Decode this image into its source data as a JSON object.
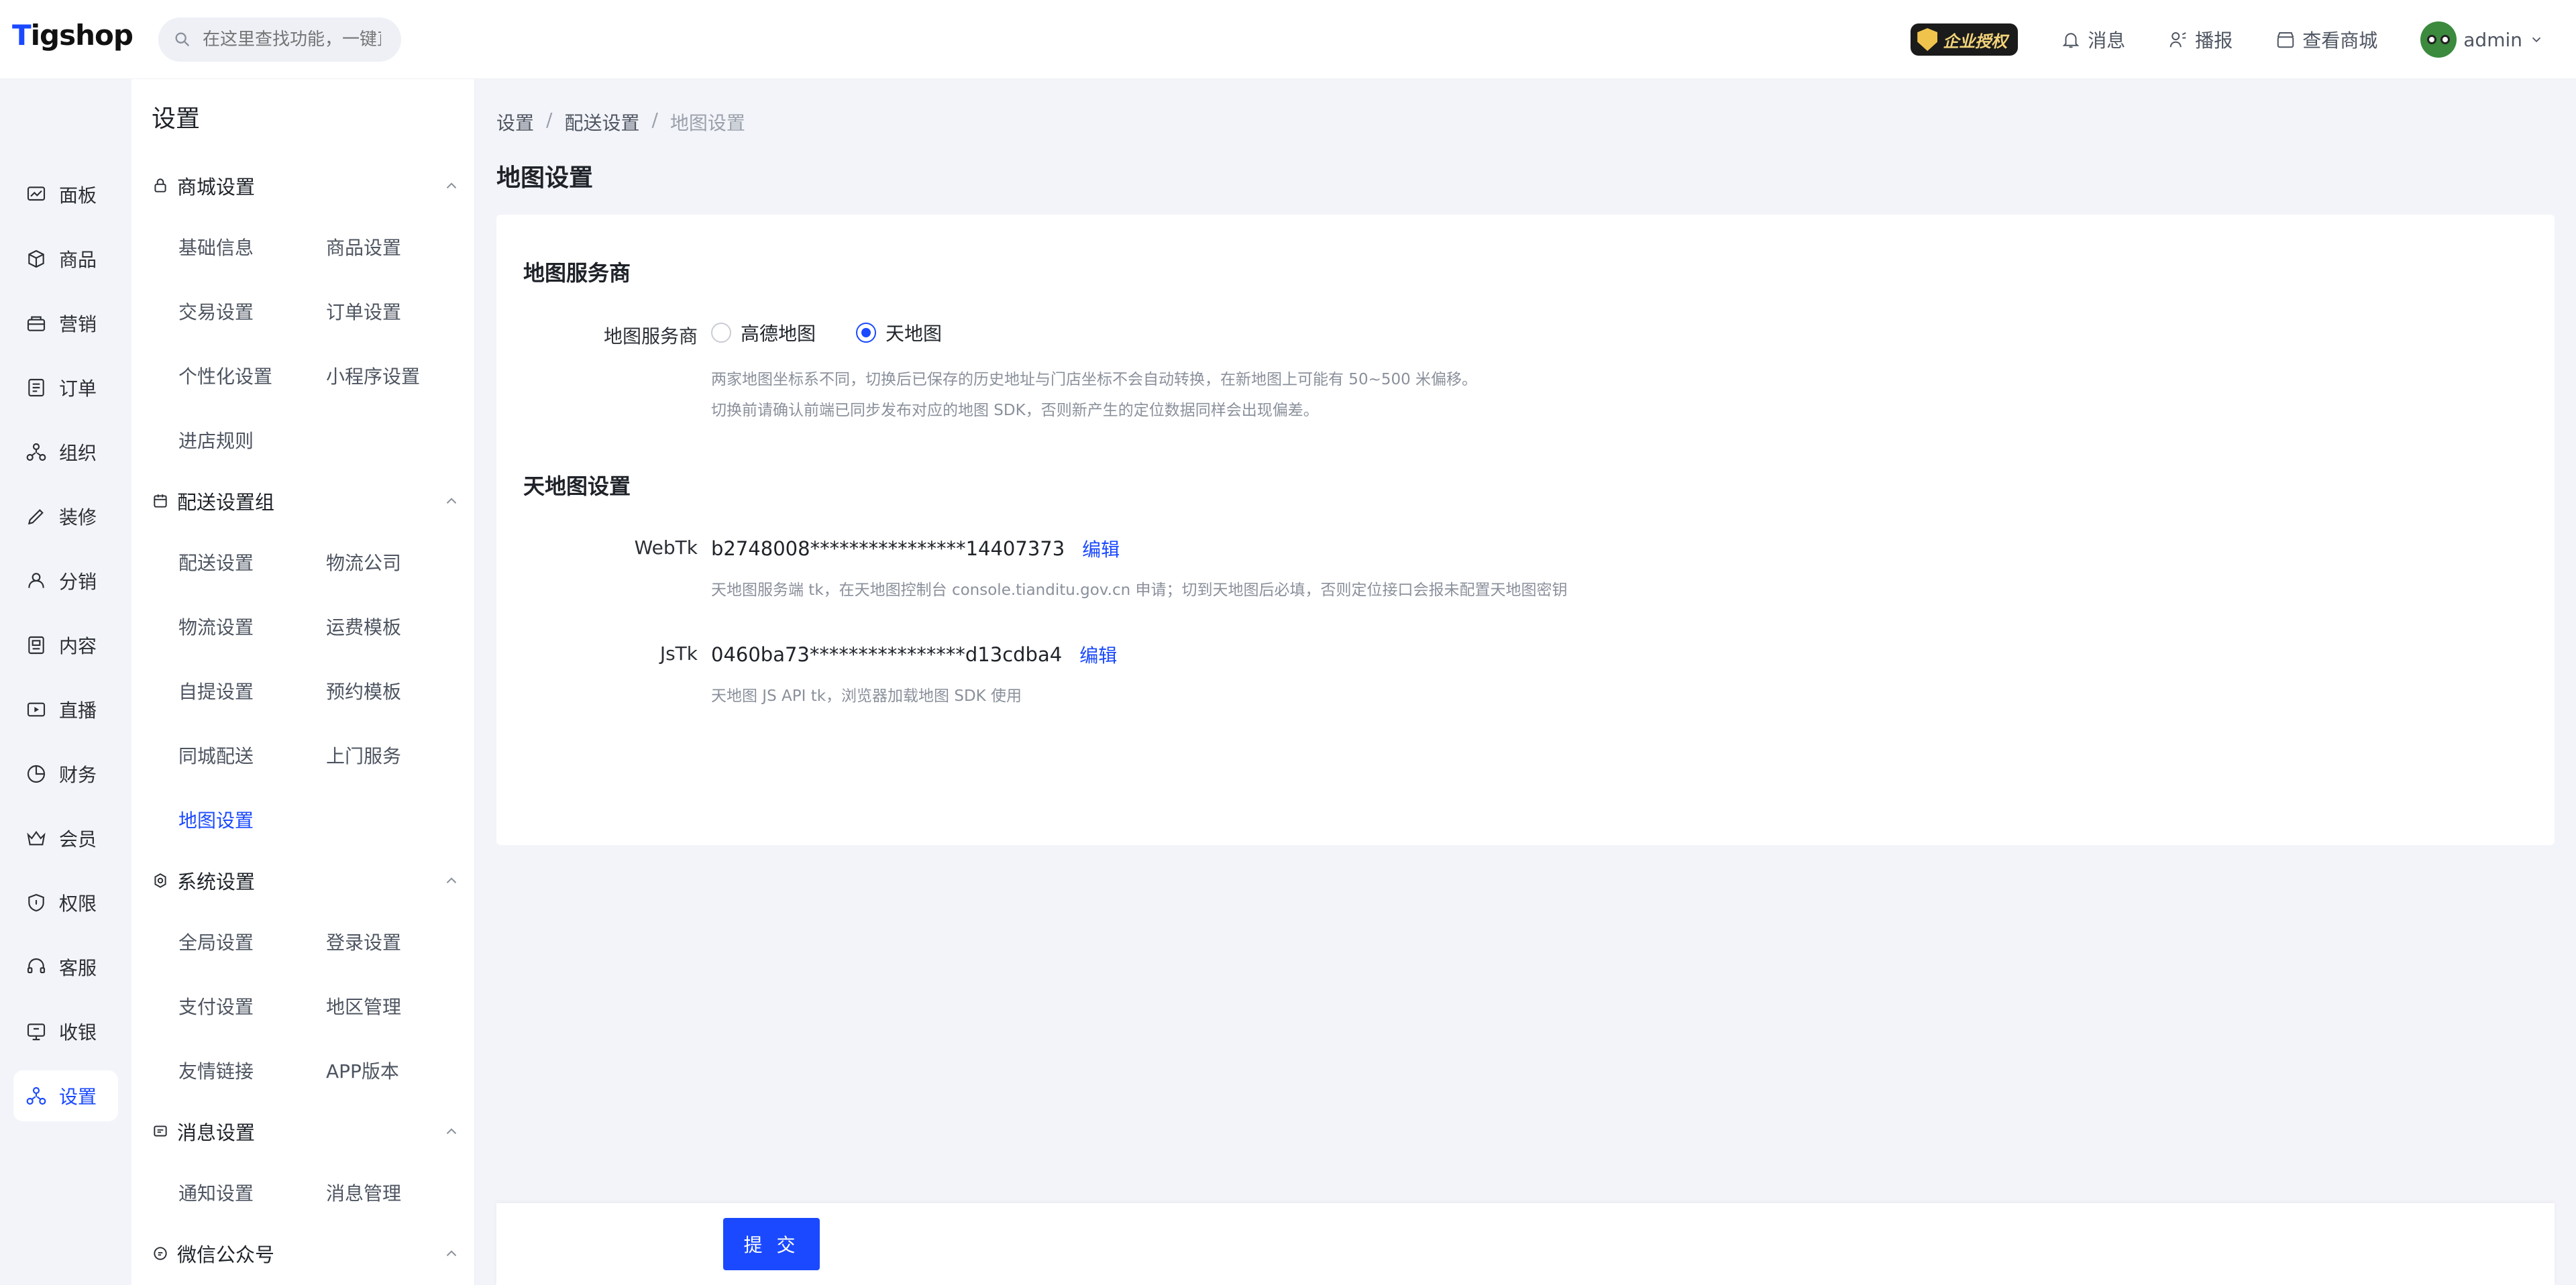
{
  "app": {
    "logo": "Tigshop",
    "search_placeholder": "在这里查找功能，一键直达"
  },
  "topbar": {
    "badge": "企业授权",
    "messages": "消息",
    "broadcast": "播报",
    "view_store": "查看商城",
    "user": "admin"
  },
  "leftnav": {
    "items": [
      {
        "label": "面板",
        "icon": "chart-icon"
      },
      {
        "label": "商品",
        "icon": "box-icon"
      },
      {
        "label": "营销",
        "icon": "marketing-icon"
      },
      {
        "label": "订单",
        "icon": "order-icon"
      },
      {
        "label": "组织",
        "icon": "org-icon"
      },
      {
        "label": "装修",
        "icon": "decorate-icon"
      },
      {
        "label": "分销",
        "icon": "distribution-icon"
      },
      {
        "label": "内容",
        "icon": "content-icon"
      },
      {
        "label": "直播",
        "icon": "live-icon"
      },
      {
        "label": "财务",
        "icon": "finance-icon"
      },
      {
        "label": "会员",
        "icon": "member-icon"
      },
      {
        "label": "权限",
        "icon": "permission-icon"
      },
      {
        "label": "客服",
        "icon": "service-icon"
      },
      {
        "label": "收银",
        "icon": "cashier-icon"
      },
      {
        "label": "设置",
        "icon": "settings-icon"
      }
    ],
    "active": "设置"
  },
  "subpanel": {
    "title": "设置",
    "groups": [
      {
        "title": "商城设置",
        "links": [
          "基础信息",
          "商品设置",
          "交易设置",
          "订单设置",
          "个性化设置",
          "小程序设置",
          "进店规则"
        ]
      },
      {
        "title": "配送设置组",
        "links": [
          "配送设置",
          "物流公司",
          "物流设置",
          "运费模板",
          "自提设置",
          "预约模板",
          "同城配送",
          "上门服务",
          "地图设置"
        ]
      },
      {
        "title": "系统设置",
        "links": [
          "全局设置",
          "登录设置",
          "支付设置",
          "地区管理",
          "友情链接",
          "APP版本"
        ]
      },
      {
        "title": "消息设置",
        "links": [
          "通知设置",
          "消息管理"
        ]
      },
      {
        "title": "微信公众号",
        "links": []
      }
    ],
    "active_link": "地图设置"
  },
  "main": {
    "breadcrumb": [
      "设置",
      "配送设置",
      "地图设置"
    ],
    "page_title": "地图设置",
    "section1": {
      "title": "地图服务商",
      "label": "地图服务商",
      "options": [
        "高德地图",
        "天地图"
      ],
      "selected": "天地图",
      "hint1": "两家地图坐标系不同，切换后已保存的历史地址与门店坐标不会自动转换，在新地图上可能有 50~500 米偏移。",
      "hint2": "切换前请确认前端已同步发布对应的地图 SDK，否则新产生的定位数据同样会出现偏差。"
    },
    "section2": {
      "title": "天地图设置",
      "webtk_label": "WebTk",
      "webtk_value": "b2748008****************14407373",
      "webtk_hint": "天地图服务端 tk，在天地图控制台 console.tianditu.gov.cn 申请；切到天地图后必填，否则定位接口会报未配置天地图密钥",
      "jstk_label": "JsTk",
      "jstk_value": "0460ba73****************d13cdba4",
      "jstk_hint": "天地图 JS API tk，浏览器加载地图 SDK 使用",
      "edit_label": "编辑"
    },
    "submit_label": "提 交"
  },
  "colors": {
    "accent": "#1a49ff",
    "background": "#f3f4f9"
  }
}
